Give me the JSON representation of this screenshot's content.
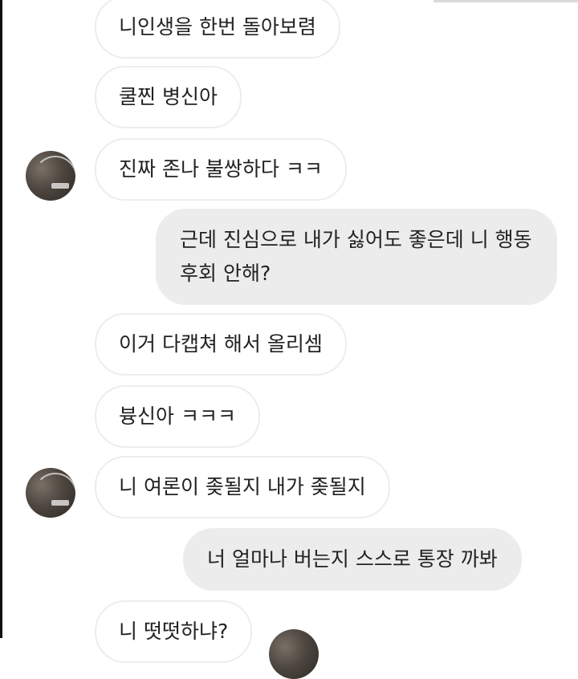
{
  "chat": {
    "messages": [
      {
        "sender": "them",
        "text": "니인생을 한번 돌아보렴"
      },
      {
        "sender": "them",
        "text": "쿨찐 병신아"
      },
      {
        "sender": "them",
        "text": "진짜 존나 불쌍하다 ㅋㅋ"
      },
      {
        "sender": "me",
        "text": "근데 진심으로 내가 싫어도 좋은데 니 행동 후회 안해?"
      },
      {
        "sender": "them",
        "text": "이거 다캡쳐 해서 올리셈"
      },
      {
        "sender": "them",
        "text": "븅신아 ㅋㅋㅋ"
      },
      {
        "sender": "them",
        "text": "니 여론이 좆될지 내가 좆될지"
      },
      {
        "sender": "me",
        "text": "너 얼마나 버는지 스스로 통장 까봐"
      },
      {
        "sender": "them",
        "text": "니 떳떳하냐?"
      }
    ]
  }
}
